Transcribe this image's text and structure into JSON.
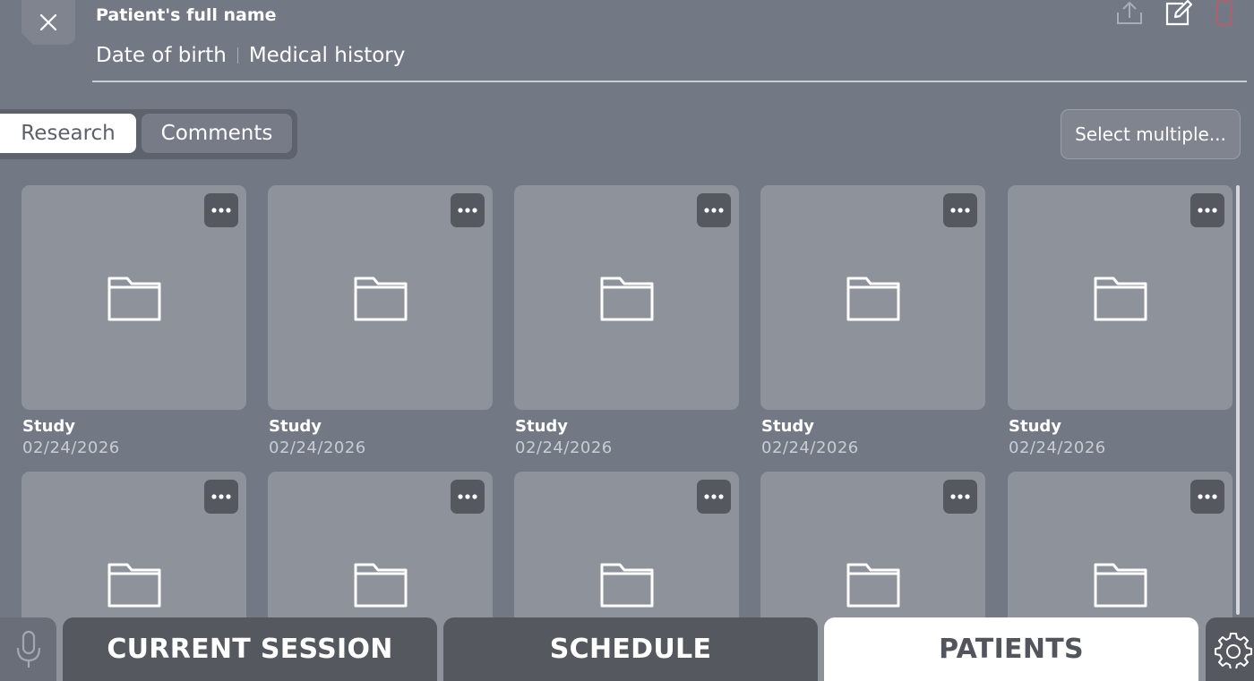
{
  "header": {
    "patient_name": "Patient's full name",
    "date_of_birth": "Date of birth",
    "medical_history": "Medical history",
    "icons": [
      "close-icon",
      "share-icon",
      "edit-icon",
      "delete-icon"
    ]
  },
  "tabs": [
    {
      "label": "Research",
      "active": true
    },
    {
      "label": "Comments",
      "active": false
    }
  ],
  "select_multiple_label": "Select multiple...",
  "studies": [
    {
      "title": "Study",
      "date": "02/24/2026"
    },
    {
      "title": "Study",
      "date": "02/24/2026"
    },
    {
      "title": "Study",
      "date": "02/24/2026"
    },
    {
      "title": "Study",
      "date": "02/24/2026"
    },
    {
      "title": "Study",
      "date": "02/24/2026"
    },
    {
      "title": "",
      "date": ""
    },
    {
      "title": "",
      "date": ""
    },
    {
      "title": "",
      "date": ""
    },
    {
      "title": "",
      "date": ""
    },
    {
      "title": "",
      "date": ""
    }
  ],
  "bottom_nav": {
    "current_session": "CURRENT SESSION",
    "schedule": "SCHEDULE",
    "patients": "PATIENTS",
    "active": "PATIENTS"
  },
  "colors": {
    "background": "#737885",
    "tile": "#8e929b",
    "dark_button": "#55585f",
    "active": "#ffffff",
    "delete_accent": "#b0606a"
  }
}
